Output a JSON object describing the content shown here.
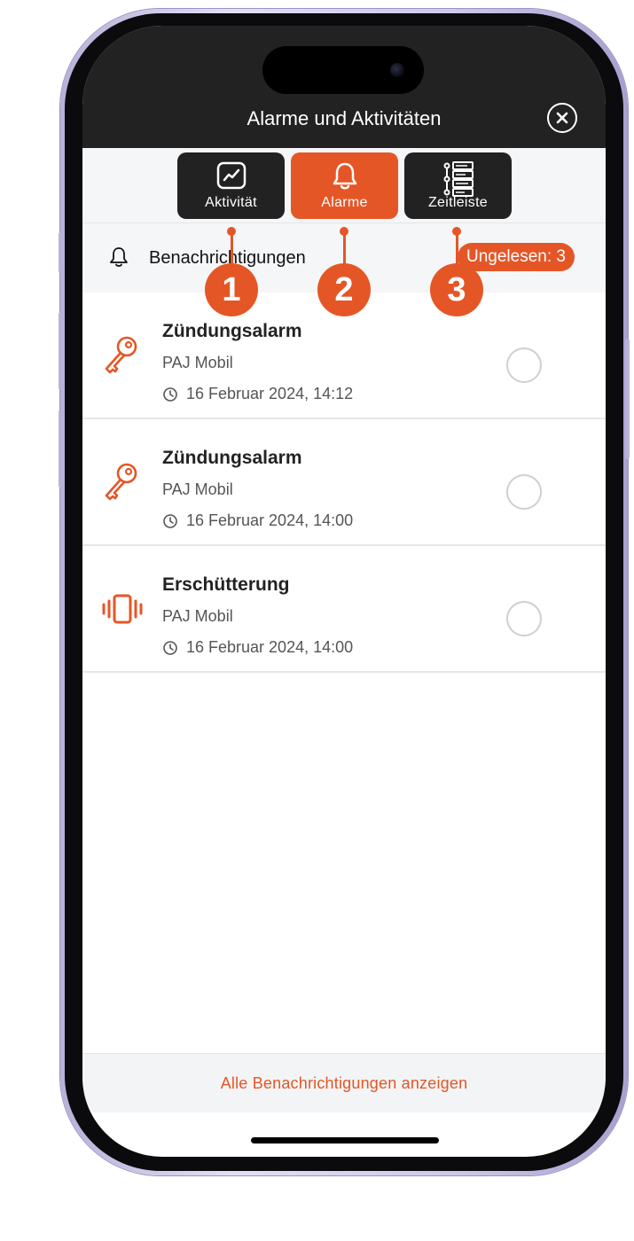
{
  "header": {
    "title": "Alarme und Aktivitäten"
  },
  "tabs": [
    {
      "label": "Aktivität",
      "icon": "activity-chart-icon"
    },
    {
      "label": "Alarme",
      "icon": "bell-icon",
      "active": true
    },
    {
      "label": "Zeitleiste",
      "icon": "timeline-icon"
    }
  ],
  "notifications_header": {
    "label": "Benachrichtigungen",
    "unread": "Ungelesen: 3"
  },
  "items": [
    {
      "title": "Zündungsalarm",
      "subtitle": "PAJ Mobil",
      "date": "16 Februar 2024, 14:12",
      "icon": "key-icon"
    },
    {
      "title": "Zündungsalarm",
      "subtitle": "PAJ Mobil",
      "date": "16 Februar 2024, 14:00",
      "icon": "key-icon"
    },
    {
      "title": "Erschütterung",
      "subtitle": "PAJ Mobil",
      "date": "16 Februar 2024, 14:00",
      "icon": "vibration-icon"
    }
  ],
  "footer": {
    "link": "Alle Benachrichtigungen anzeigen"
  },
  "callouts": [
    "1",
    "2",
    "3"
  ],
  "colors": {
    "accent": "#e55626",
    "dark": "#222222",
    "background": "#f5f6f8"
  }
}
